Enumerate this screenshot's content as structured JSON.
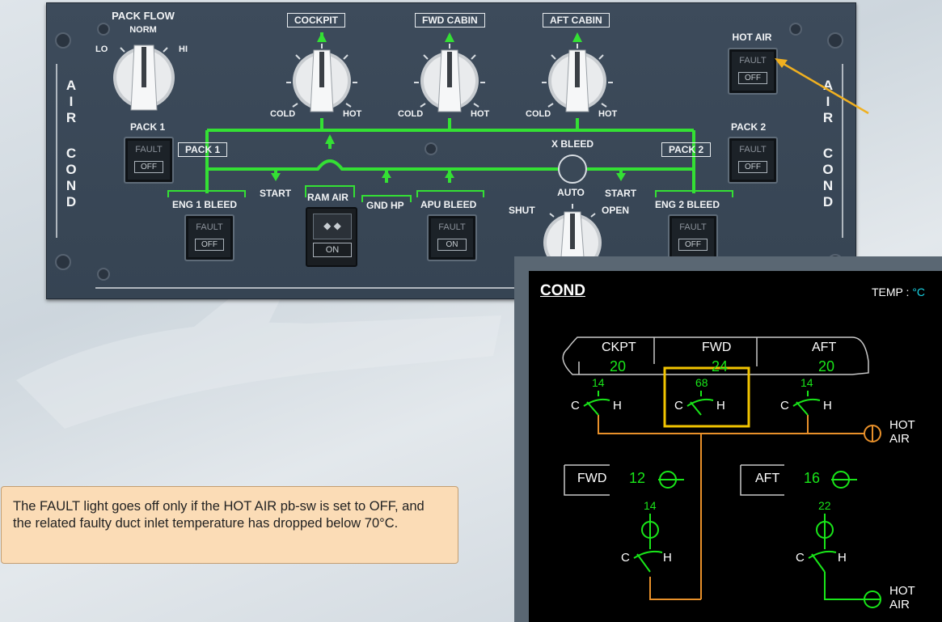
{
  "overhead": {
    "pack_flow": {
      "title": "PACK FLOW",
      "norm": "NORM",
      "lo": "LO",
      "hi": "HI"
    },
    "selectors": [
      {
        "label": "COCKPIT",
        "cold": "COLD",
        "hot": "HOT"
      },
      {
        "label": "FWD CABIN",
        "cold": "COLD",
        "hot": "HOT"
      },
      {
        "label": "AFT CABIN",
        "cold": "COLD",
        "hot": "HOT"
      }
    ],
    "side_label": [
      "A",
      "I",
      "R",
      "C",
      "O",
      "N",
      "D"
    ],
    "hot_air": {
      "label": "HOT AIR",
      "fault": "FAULT",
      "state": "OFF"
    },
    "pack1": {
      "label": "PACK 1",
      "box": "PACK 1",
      "fault": "FAULT",
      "state": "OFF"
    },
    "pack2": {
      "label": "PACK 2",
      "box": "PACK 2",
      "fault": "FAULT",
      "state": "OFF"
    },
    "x_bleed": {
      "label": "X BLEED",
      "auto": "AUTO",
      "shut": "SHUT",
      "open": "OPEN"
    },
    "eng1_bleed": {
      "label": "ENG 1 BLEED",
      "fault": "FAULT",
      "state": "OFF"
    },
    "eng2_bleed": {
      "label": "ENG 2 BLEED",
      "fault": "FAULT",
      "state": "OFF"
    },
    "apu_bleed": {
      "label": "APU BLEED",
      "fault": "FAULT",
      "state": "ON"
    },
    "ram_air": {
      "label": "RAM AIR",
      "state": "ON"
    },
    "gnd_hp": "GND HP",
    "start_left": "START",
    "start_right": "START"
  },
  "ecam": {
    "title": "COND",
    "temp_label": "TEMP :",
    "temp_unit": "°C",
    "zones": [
      {
        "name": "CKPT",
        "temp": "20",
        "duct": "14"
      },
      {
        "name": "FWD",
        "temp": "24",
        "duct": "68"
      },
      {
        "name": "AFT",
        "temp": "20",
        "duct": "14"
      }
    ],
    "valve_c": "C",
    "valve_h": "H",
    "hot_air_label": [
      "HOT",
      "AIR"
    ],
    "cargo": [
      {
        "name": "FWD",
        "temp": "12",
        "duct": "14"
      },
      {
        "name": "AFT",
        "temp": "16",
        "duct": "22"
      }
    ]
  },
  "note": {
    "text": "The FAULT light goes off only if the HOT AIR pb-sw is set to OFF, and the related faulty duct inlet temperature has dropped below 70°C."
  },
  "colors": {
    "green": "#19e619",
    "amber": "#e8902a",
    "highlight": "#f2c400",
    "callout": "#f0b020",
    "ecam_cyan": "#19d5e6"
  }
}
